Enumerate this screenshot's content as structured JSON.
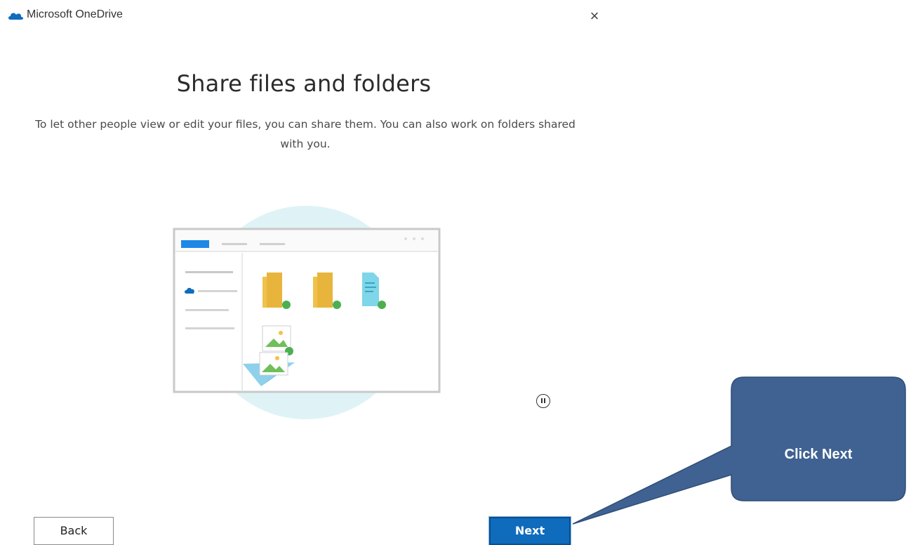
{
  "window": {
    "app_title": "Microsoft OneDrive",
    "app_icon": "onedrive-cloud-icon",
    "close_icon": "close-icon",
    "close_glyph": "×"
  },
  "main": {
    "title": "Share files and folders",
    "description": "To let other people view or edit your files, you can share them. You can also work on folders shared with you."
  },
  "illustration": {
    "icons": [
      "folder-icon",
      "folder-icon",
      "document-icon",
      "image-icon",
      "paper-plane-icon",
      "cloud-icon"
    ]
  },
  "controls": {
    "pause_icon": "pause-icon",
    "back_label": "Back",
    "next_label": "Next"
  },
  "callout": {
    "text": "Click Next"
  },
  "colors": {
    "accent": "#0f6cbd",
    "callout_fill": "#3f6292",
    "illustration_circle": "#dff3f6"
  }
}
